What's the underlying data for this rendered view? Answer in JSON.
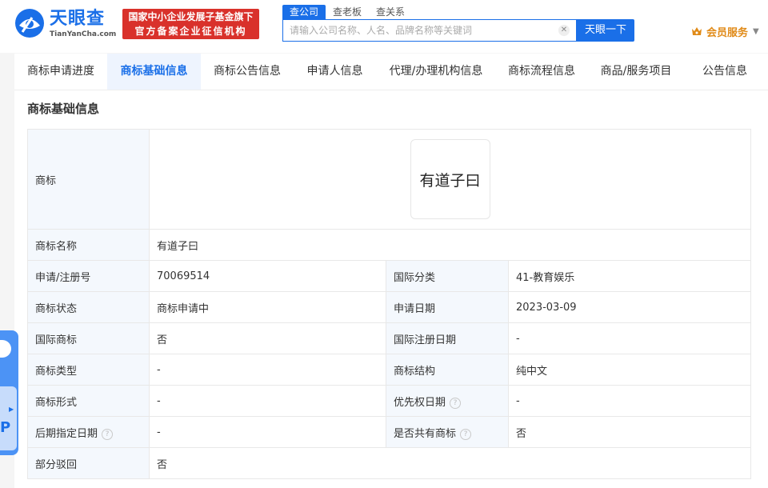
{
  "header": {
    "logo_cn": "天眼查",
    "logo_en": "TianYanCha.com",
    "banner_line1": "国家中小企业发展子基金旗下",
    "banner_line2": "官方备案企业征信机构",
    "search_tabs": [
      "查公司",
      "查老板",
      "查关系"
    ],
    "search_placeholder": "请输入公司名称、人名、品牌名称等关键词",
    "search_button": "天眼一下",
    "member_label": "会员服务",
    "clear_icon": "close-icon",
    "accent_color": "#1a6fe8"
  },
  "tabs": [
    "商标申请进度",
    "商标基础信息",
    "商标公告信息",
    "申请人信息",
    "代理/办理机构信息",
    "商标流程信息",
    "商品/服务项目",
    "公告信息"
  ],
  "active_tab": 1,
  "section": {
    "title": "商标基础信息"
  },
  "trademark": {
    "image_label": "商标",
    "image_text": "有道子曰",
    "name_label": "商标名称",
    "name_value": "有道子曰",
    "rows": [
      {
        "l1": "申请/注册号",
        "v1": "70069514",
        "l2": "国际分类",
        "v2": "41-教育娱乐"
      },
      {
        "l1": "商标状态",
        "v1": "商标申请中",
        "l2": "申请日期",
        "v2": "2023-03-09"
      },
      {
        "l1": "国际商标",
        "v1": "否",
        "l2": "国际注册日期",
        "v2": "-"
      },
      {
        "l1": "商标类型",
        "v1": "-",
        "l2": "商标结构",
        "v2": "纯中文"
      },
      {
        "l1": "商标形式",
        "v1": "-",
        "l2": "优先权日期",
        "v2": "-"
      },
      {
        "l1": "后期指定日期",
        "v1": "-",
        "l2": "是否共有商标",
        "v2": "否"
      }
    ],
    "last_label": "部分驳回",
    "last_value": "否"
  }
}
